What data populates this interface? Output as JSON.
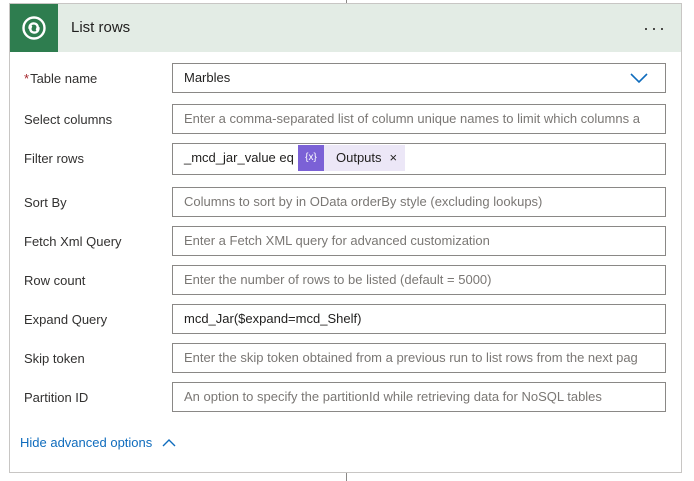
{
  "card": {
    "title": "List rows",
    "more_label": "···",
    "icon": "dataverse-icon",
    "accent_color": "#2e7d4f",
    "header_bg": "#e3ece5"
  },
  "fields": {
    "table_name": {
      "label": "Table name",
      "required_mark": "*",
      "value": "Marbles"
    },
    "select_columns": {
      "label": "Select columns",
      "placeholder": "Enter a comma-separated list of column unique names to limit which columns a"
    },
    "filter_rows": {
      "label": "Filter rows",
      "value_text": "_mcd_jar_value eq",
      "token_label": "Outputs",
      "token_icon_text": "{x}",
      "token_close": "×"
    },
    "sort_by": {
      "label": "Sort By",
      "placeholder": "Columns to sort by in OData orderBy style (excluding lookups)"
    },
    "fetch_xml": {
      "label": "Fetch Xml Query",
      "placeholder": "Enter a Fetch XML query for advanced customization"
    },
    "row_count": {
      "label": "Row count",
      "placeholder": "Enter the number of rows to be listed (default = 5000)"
    },
    "expand_query": {
      "label": "Expand Query",
      "value": "mcd_Jar($expand=mcd_Shelf)"
    },
    "skip_token": {
      "label": "Skip token",
      "placeholder": "Enter the skip token obtained from a previous run to list rows from the next pag"
    },
    "partition_id": {
      "label": "Partition ID",
      "placeholder": "An option to specify the partitionId while retrieving data for NoSQL tables"
    }
  },
  "footer": {
    "advanced_toggle_label": "Hide advanced options"
  }
}
